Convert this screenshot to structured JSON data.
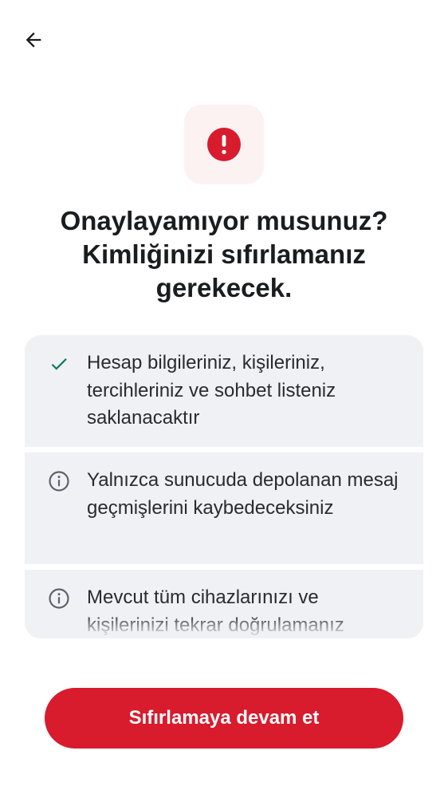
{
  "header": {
    "back_icon": "arrow-left-icon"
  },
  "hero": {
    "icon": "error-exclamation-icon",
    "icon_color": "#d81b2d",
    "icon_bg": "#fdf2f2"
  },
  "title": {
    "line1": "Onaylayamıyor musunuz?",
    "line2": "Kimliğinizi sıfırlamanız",
    "line3": "gerekecek."
  },
  "items": [
    {
      "icon": "checkmark-icon",
      "icon_color": "#0f7a5c",
      "text": "Hesap bilgileriniz, kişileriniz, tercihleriniz ve sohbet listeniz saklanacaktır"
    },
    {
      "icon": "info-icon",
      "icon_color": "#5f6368",
      "text": "Yalnızca sunucuda depolanan mesaj geçmişlerini kaybedeceksiniz"
    },
    {
      "icon": "info-icon",
      "icon_color": "#5f6368",
      "text": "Mevcut tüm cihazlarınızı ve kişilerinizi tekrar doğrulamanız"
    }
  ],
  "primary_button": {
    "label": "Sıfırlamaya devam et",
    "color": "#d81b2d"
  }
}
